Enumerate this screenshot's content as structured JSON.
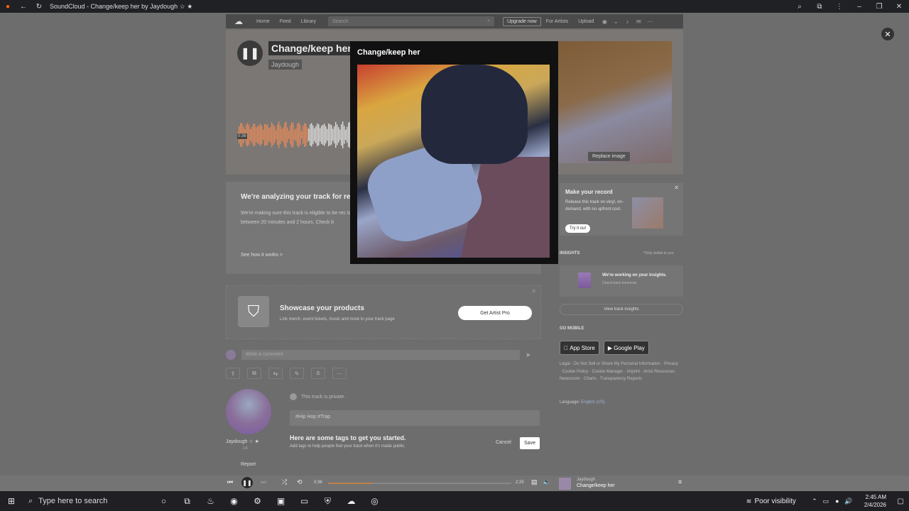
{
  "browser": {
    "tab_title": "SoundCloud - Change/keep her by Jaydough ☆ ★"
  },
  "header": {
    "nav": [
      "Home",
      "Feed",
      "Library"
    ],
    "search_placeholder": "Search",
    "upgrade_label": "Upgrade now",
    "for_artists_label": "For Artists",
    "upload_label": "Upload"
  },
  "track": {
    "title": "Change/keep her",
    "artist": "Jaydough",
    "current_time": "0:36",
    "replace_image_label": "Replace image"
  },
  "analyze": {
    "title": "We're analyzing your track for re",
    "body": "We're making sure this track is eligible to be rec takes between 20 minutes and 2 hours. Check b",
    "see_how": "See how it works >"
  },
  "showcase": {
    "title": "Showcase your products",
    "subtitle": "Link merch, event tickets, music and more to your track page",
    "button": "Get Artist Pro"
  },
  "comment": {
    "placeholder": "Write a comment"
  },
  "artist_card": {
    "name": "Jaydough ☆ ★",
    "followers": "14",
    "report": "Report"
  },
  "tags": {
    "private_note": "This track is private.",
    "value": "#Hip Hop  #Trap",
    "hint_title": "Here are some tags to get you started.",
    "hint_sub": "Add tags to help people find your track when it's made public.",
    "cancel": "Cancel",
    "save": "Save"
  },
  "sidebar": {
    "vinyl_title": "Make your record",
    "vinyl_body": "Release this track on vinyl, on-demand, with no upfront cost.",
    "vinyl_button": "Try it out",
    "insights_label": "INSIGHTS",
    "visible_note": "*Only visible to you",
    "insights_title": "We're working on your insights.",
    "insights_sub": "Check back tomorrow",
    "view_insights": "View track insights",
    "go_mobile": "GO MOBILE",
    "app_store": "App Store",
    "google_play": "Google Play",
    "footer_links": "Legal · Do Not Sell or Share My Personal Information · Privacy · Cookie Policy · Cookie Manager · Imprint · Artist Resources · Newsroom · Charts · Transparency Reports",
    "language_label": "Language:",
    "language_value": "English (US)"
  },
  "modal": {
    "title": "Change/keep her"
  },
  "player": {
    "current": "0:36",
    "duration": "2:25",
    "progress": 0.24,
    "artist": "Jaydough",
    "title": "Change/keep her"
  },
  "taskbar": {
    "search_placeholder": "Type here to search",
    "weather": "Poor visibility",
    "time": "2:45 AM",
    "date": "2/4/2026"
  }
}
